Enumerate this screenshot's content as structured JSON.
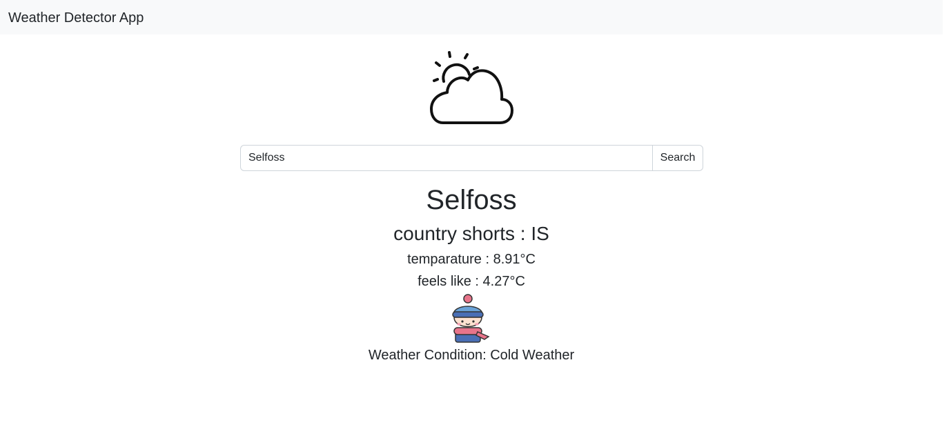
{
  "navbar": {
    "brand": "Weather Detector App"
  },
  "hero": {
    "icon": "partly-cloudy-icon"
  },
  "search": {
    "value": "Selfoss",
    "button_label": "Search"
  },
  "weather": {
    "city": "Selfoss",
    "country_text": "country shorts : IS",
    "temperature_text": "temparature : 8.91°C",
    "feels_like_text": "feels like : 4.27°C",
    "condition_icon": "cold-child-icon",
    "condition_text": "Weather Condition: Cold Weather"
  }
}
